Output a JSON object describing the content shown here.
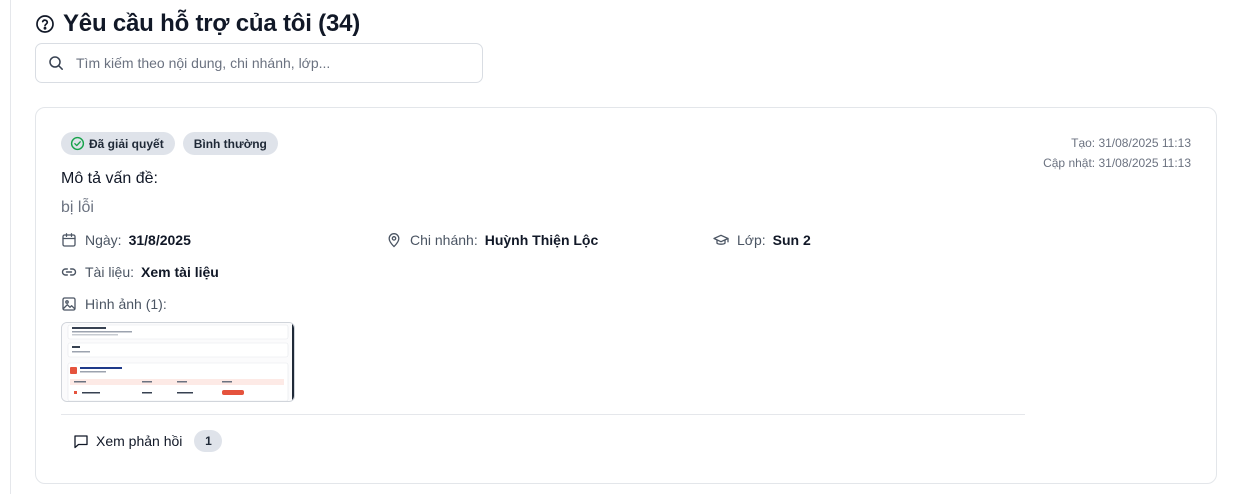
{
  "header": {
    "title": "Yêu cầu hỗ trợ của tôi (34)",
    "icon": "help-circle-icon"
  },
  "search": {
    "placeholder": "Tìm kiếm theo nội dung, chi nhánh, lớp...",
    "value": ""
  },
  "ticket": {
    "status_badge": "Đã giải quyết",
    "priority_badge": "Bình thường",
    "created": "Tạo: 31/08/2025 11:13",
    "updated": "Cập nhật: 31/08/2025 11:13",
    "description_label": "Mô tả vấn đề:",
    "description": "bị lỗi",
    "date_label": "Ngày:",
    "date_value": "31/8/2025",
    "branch_label": "Chi nhánh:",
    "branch_value": "Huỳnh Thiện Lộc",
    "class_label": "Lớp:",
    "class_value": "Sun 2",
    "doc_label": "Tài liệu:",
    "doc_value": "Xem tài liệu",
    "images_label": "Hình ảnh (1):",
    "feedback_label": "Xem phản hồi",
    "feedback_count": "1"
  },
  "colors": {
    "badge_bg": "#dfe3ea",
    "success_green": "#16a34a",
    "accent_red": "#e5533d"
  }
}
